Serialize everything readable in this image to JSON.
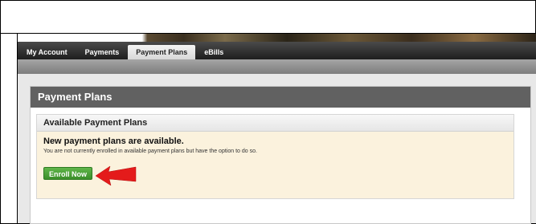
{
  "nav": {
    "items": [
      {
        "label": "My Account"
      },
      {
        "label": "Payments"
      },
      {
        "label": "Payment Plans"
      },
      {
        "label": "eBills"
      }
    ],
    "active_index": 2
  },
  "panel": {
    "title": "Payment Plans",
    "sub_title": "Available Payment Plans",
    "notice_title": "New payment plans are available.",
    "notice_text": "You are not currently enrolled in available payment plans but have the option to do so.",
    "enroll_label": "Enroll Now"
  },
  "colors": {
    "nav_bar": "#1e1e1e",
    "panel_header": "#616161",
    "notice_bg": "#fbf2dd",
    "button": "#4aa036",
    "arrow": "#e41b1b"
  },
  "icons": {
    "annotation": "red-arrow-icon"
  }
}
